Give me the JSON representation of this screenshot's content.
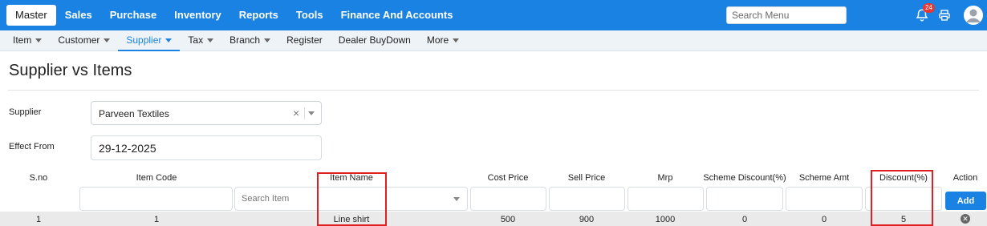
{
  "topnav": {
    "items": [
      "Master",
      "Sales",
      "Purchase",
      "Inventory",
      "Reports",
      "Tools",
      "Finance And Accounts"
    ],
    "active": "Master",
    "search_placeholder": "Search Menu",
    "notification_count": "24"
  },
  "subnav": {
    "items": [
      {
        "label": "Item",
        "dropdown": true
      },
      {
        "label": "Customer",
        "dropdown": true
      },
      {
        "label": "Supplier",
        "dropdown": true
      },
      {
        "label": "Tax",
        "dropdown": true
      },
      {
        "label": "Branch",
        "dropdown": true
      },
      {
        "label": "Register",
        "dropdown": false
      },
      {
        "label": "Dealer BuyDown",
        "dropdown": false
      },
      {
        "label": "More",
        "dropdown": true
      }
    ],
    "active": "Supplier"
  },
  "page": {
    "title": "Supplier vs Items"
  },
  "form": {
    "supplier_label": "Supplier",
    "supplier_value": "Parveen Textiles",
    "effect_from_label": "Effect From",
    "effect_from_value": "29-12-2025"
  },
  "table": {
    "headers": {
      "sno": "S.no",
      "item_code": "Item Code",
      "item_name": "Item Name",
      "cost_price": "Cost Price",
      "sell_price": "Sell Price",
      "mrp": "Mrp",
      "scheme_discount": "Scheme Discount(%)",
      "scheme_amt": "Scheme Amt",
      "discount": "Discount(%)",
      "action": "Action"
    },
    "search_item_placeholder": "Search Item",
    "add_label": "Add",
    "rows": [
      {
        "sno": "1",
        "item_code": "1",
        "item_name": "Line shirt",
        "cost_price": "500",
        "sell_price": "900",
        "mrp": "1000",
        "scheme_discount": "0",
        "scheme_amt": "0",
        "discount": "5"
      }
    ]
  },
  "colors": {
    "brand": "#1a82e2",
    "highlight": "#e02020",
    "badge": "#e53935"
  },
  "icons": [
    "bell-icon",
    "printer-icon",
    "avatar-icon",
    "clear-icon",
    "chevron-down-icon",
    "delete-icon"
  ]
}
